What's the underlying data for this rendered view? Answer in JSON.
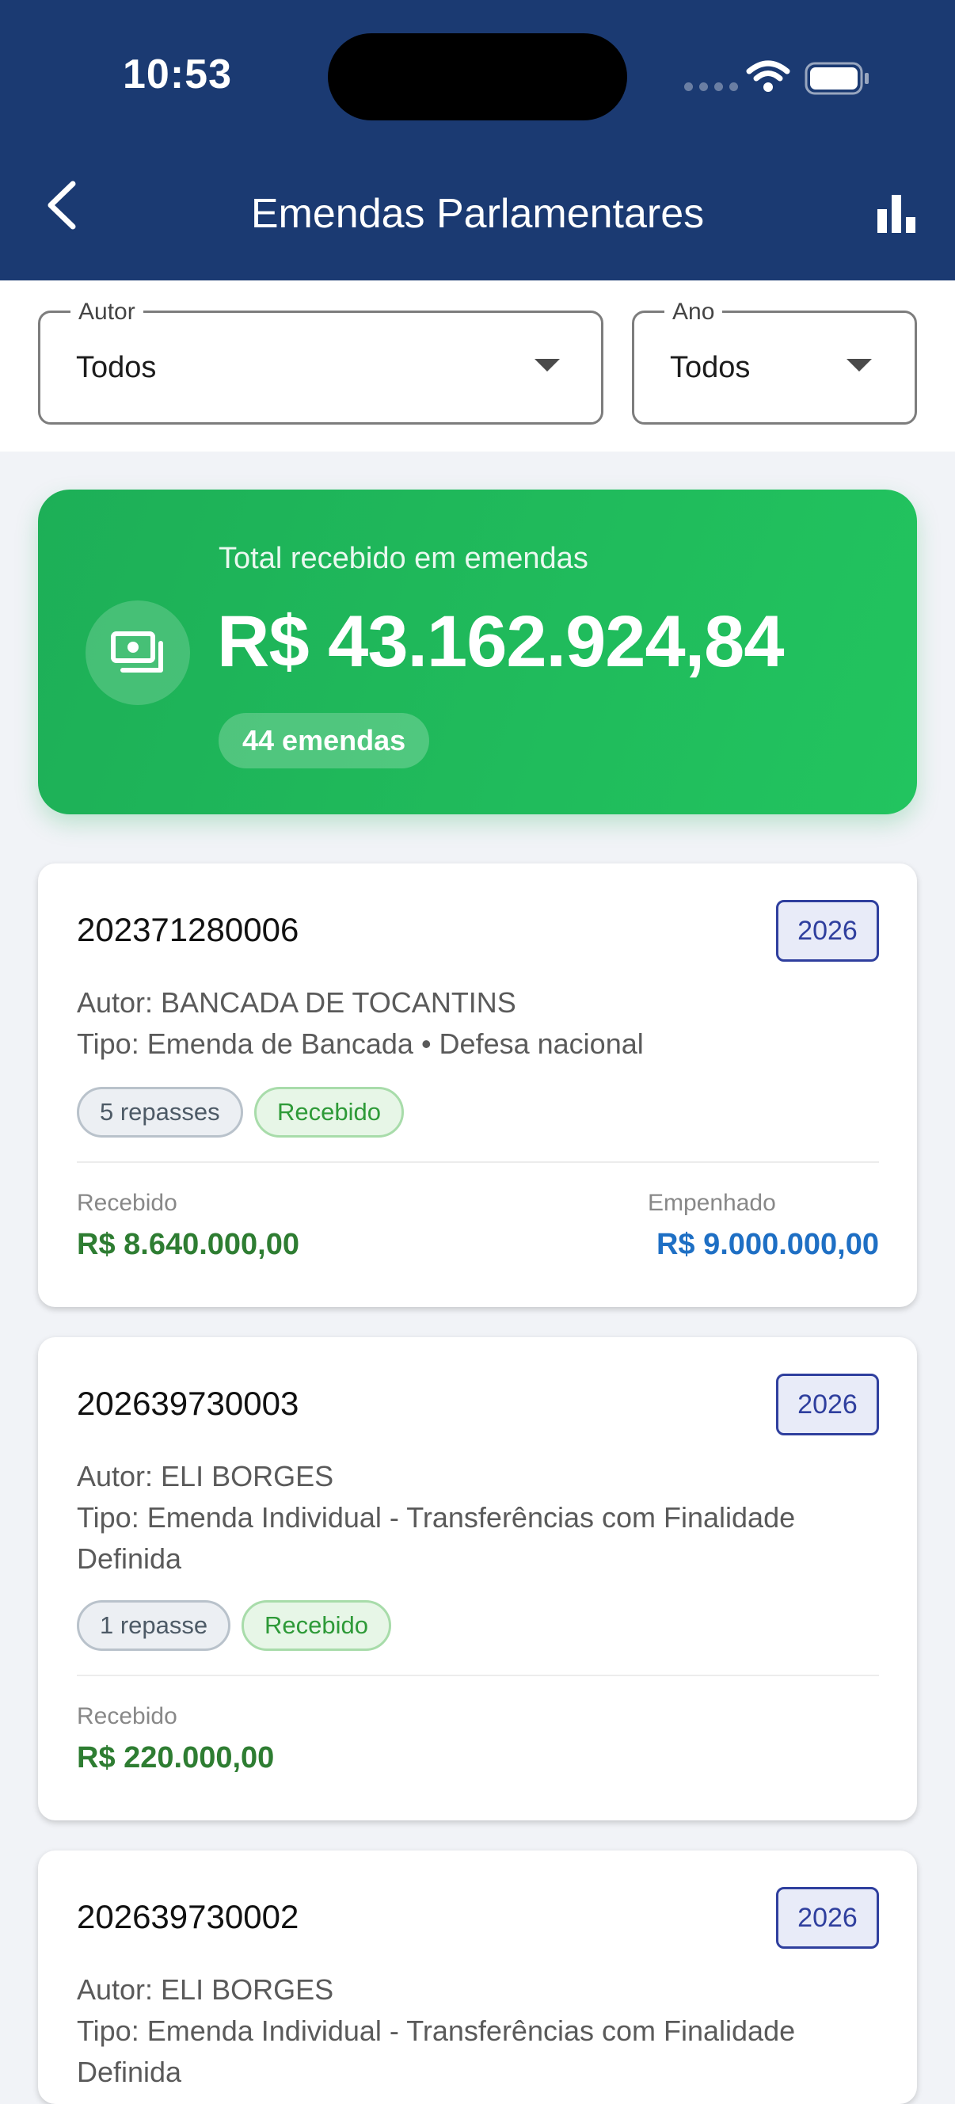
{
  "status_bar": {
    "time": "10:53",
    "icons": [
      "cellular-signal-icon",
      "wifi-icon",
      "battery-icon"
    ]
  },
  "header": {
    "title": "Emendas Parlamentares",
    "back_icon": "chevron-left-icon",
    "chart_icon": "bar-chart-icon",
    "color": "#1b3a72"
  },
  "filters": {
    "author": {
      "label": "Autor",
      "value": "Todos"
    },
    "year": {
      "label": "Ano",
      "value": "Todos"
    }
  },
  "summary": {
    "label": "Total recebido em emendas",
    "total": "R$ 43.162.924,84",
    "count": "44 emendas",
    "icon": "money-icon",
    "color": "#22c45f"
  },
  "cards": [
    {
      "id": "202371280006",
      "year": "2026",
      "author": "Autor: BANCADA DE TOCANTINS",
      "type_line1": "Tipo: Emenda de Bancada • Defesa nacional",
      "type_line2": "",
      "repasses": "5 repasses",
      "status": "Recebido",
      "received_label": "Recebido",
      "received_value": "R$ 8.640.000,00",
      "committed_label": "Empenhado",
      "committed_value": "R$ 9.000.000,00"
    },
    {
      "id": "202639730003",
      "year": "2026",
      "author": "Autor: ELI BORGES",
      "type_line1": "Tipo: Emenda Individual - Transferências com Finalidade",
      "type_line2": "Definida",
      "repasses": "1 repasse",
      "status": "Recebido",
      "received_label": "Recebido",
      "received_value": "R$ 220.000,00"
    },
    {
      "id": "202639730002",
      "year": "2026",
      "author": "Autor: ELI BORGES",
      "type_line1": "Tipo: Emenda Individual - Transferências com Finalidade",
      "type_line2": "Definida"
    }
  ]
}
